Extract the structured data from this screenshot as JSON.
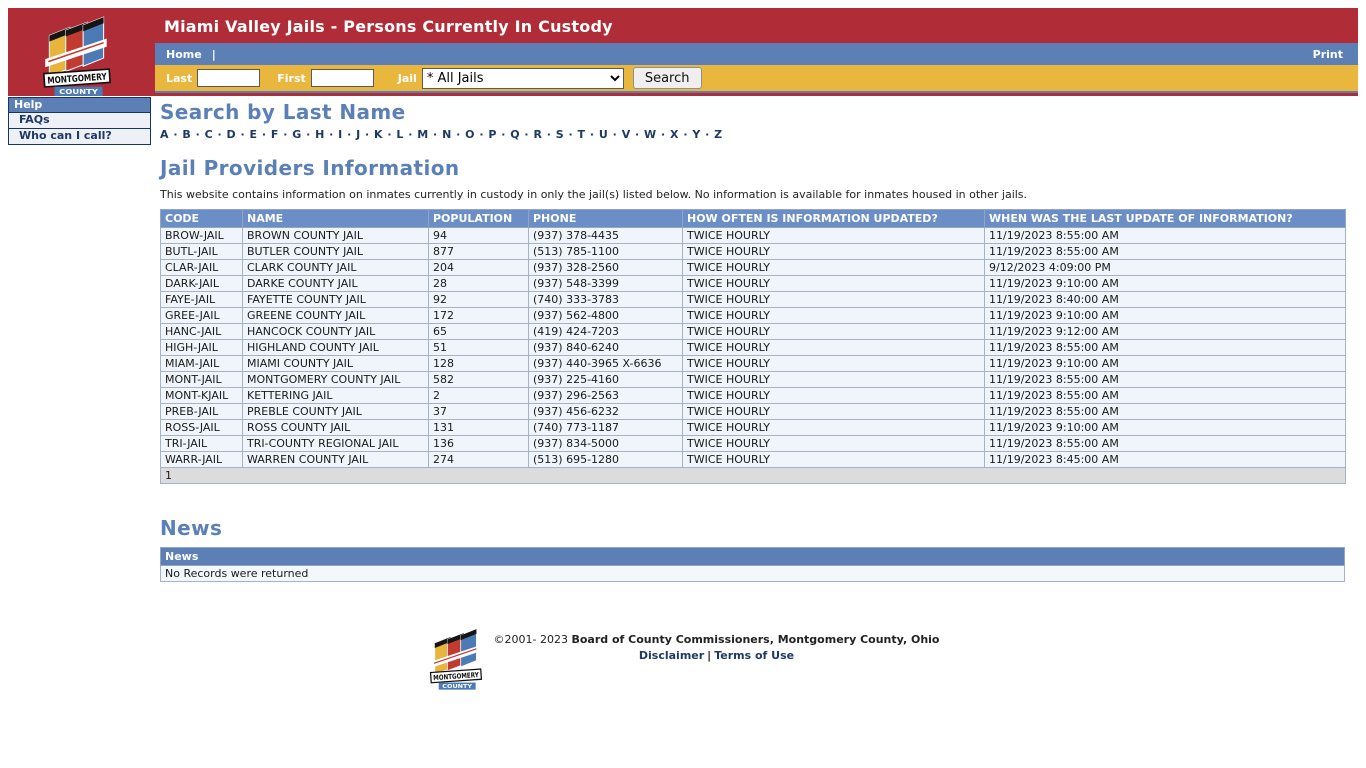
{
  "header": {
    "title": "Miami Valley Jails - Persons Currently In Custody",
    "nav": {
      "home_label": "Home",
      "separator": "|",
      "print_label": "Print"
    },
    "search_bar": {
      "last_label": "Last",
      "last_value": "",
      "first_label": "First",
      "first_value": "",
      "jail_label": "Jail",
      "jail_selected": "* All Jails",
      "search_button": "Search"
    }
  },
  "logo": {
    "line1": "MONTGOMERY",
    "line2": "COUNTY"
  },
  "sidebar": {
    "header": "Help",
    "items": [
      {
        "label": "FAQs"
      },
      {
        "label": "Who can I call?"
      }
    ]
  },
  "main": {
    "search_section": {
      "heading": "Search by Last Name",
      "letters": [
        "A",
        "B",
        "C",
        "D",
        "E",
        "F",
        "G",
        "H",
        "I",
        "J",
        "K",
        "L",
        "M",
        "N",
        "O",
        "P",
        "Q",
        "R",
        "S",
        "T",
        "U",
        "V",
        "W",
        "X",
        "Y",
        "Z"
      ]
    },
    "providers_section": {
      "heading": "Jail Providers Information",
      "description": "This website contains information on inmates currently in custody in only the jail(s) listed below. No information is available for inmates housed in other jails.",
      "table": {
        "columns": [
          "CODE",
          "NAME",
          "POPULATION",
          "PHONE",
          "HOW OFTEN IS INFORMATION UPDATED?",
          "WHEN WAS THE LAST UPDATE OF INFORMATION?"
        ],
        "rows": [
          {
            "code": "BROW-JAIL",
            "name": "BROWN COUNTY JAIL",
            "population": "94",
            "phone": "(937) 378-4435",
            "updated": "TWICE HOURLY",
            "last_update": "11/19/2023 8:55:00 AM"
          },
          {
            "code": "BUTL-JAIL",
            "name": "BUTLER COUNTY JAIL",
            "population": "877",
            "phone": "(513) 785-1100",
            "updated": "TWICE HOURLY",
            "last_update": "11/19/2023 8:55:00 AM"
          },
          {
            "code": "CLAR-JAIL",
            "name": "CLARK COUNTY JAIL",
            "population": "204",
            "phone": "(937) 328-2560",
            "updated": "TWICE HOURLY",
            "last_update": "9/12/2023 4:09:00 PM"
          },
          {
            "code": "DARK-JAIL",
            "name": "DARKE COUNTY JAIL",
            "population": "28",
            "phone": "(937) 548-3399",
            "updated": "TWICE HOURLY",
            "last_update": "11/19/2023 9:10:00 AM"
          },
          {
            "code": "FAYE-JAIL",
            "name": "FAYETTE COUNTY JAIL",
            "population": "92",
            "phone": "(740) 333-3783",
            "updated": "TWICE HOURLY",
            "last_update": "11/19/2023 8:40:00 AM"
          },
          {
            "code": "GREE-JAIL",
            "name": "GREENE COUNTY JAIL",
            "population": "172",
            "phone": "(937) 562-4800",
            "updated": "TWICE HOURLY",
            "last_update": "11/19/2023 9:10:00 AM"
          },
          {
            "code": "HANC-JAIL",
            "name": "HANCOCK COUNTY JAIL",
            "population": "65",
            "phone": "(419) 424-7203",
            "updated": "TWICE HOURLY",
            "last_update": "11/19/2023 9:12:00 AM"
          },
          {
            "code": "HIGH-JAIL",
            "name": "HIGHLAND COUNTY JAIL",
            "population": "51",
            "phone": "(937) 840-6240",
            "updated": "TWICE HOURLY",
            "last_update": "11/19/2023 8:55:00 AM"
          },
          {
            "code": "MIAM-JAIL",
            "name": "MIAMI COUNTY JAIL",
            "population": "128",
            "phone": "(937) 440-3965 X-6636",
            "updated": "TWICE HOURLY",
            "last_update": "11/19/2023 9:10:00 AM"
          },
          {
            "code": "MONT-JAIL",
            "name": "MONTGOMERY COUNTY JAIL",
            "population": "582",
            "phone": "(937) 225-4160",
            "updated": "TWICE HOURLY",
            "last_update": "11/19/2023 8:55:00 AM"
          },
          {
            "code": "MONT-KJAIL",
            "name": "KETTERING JAIL",
            "population": "2",
            "phone": "(937) 296-2563",
            "updated": "TWICE HOURLY",
            "last_update": "11/19/2023 8:55:00 AM"
          },
          {
            "code": "PREB-JAIL",
            "name": "PREBLE COUNTY JAIL",
            "population": "37",
            "phone": "(937) 456-6232",
            "updated": "TWICE HOURLY",
            "last_update": "11/19/2023 8:55:00 AM"
          },
          {
            "code": "ROSS-JAIL",
            "name": "ROSS COUNTY JAIL",
            "population": "131",
            "phone": "(740) 773-1187",
            "updated": "TWICE HOURLY",
            "last_update": "11/19/2023 9:10:00 AM"
          },
          {
            "code": "TRI-JAIL",
            "name": "TRI-COUNTY REGIONAL JAIL",
            "population": "136",
            "phone": "(937) 834-5000",
            "updated": "TWICE HOURLY",
            "last_update": "11/19/2023 8:55:00 AM"
          },
          {
            "code": "WARR-JAIL",
            "name": "WARREN COUNTY JAIL",
            "population": "274",
            "phone": "(513) 695-1280",
            "updated": "TWICE HOURLY",
            "last_update": "11/19/2023 8:45:00 AM"
          }
        ],
        "pager": "1"
      }
    },
    "news_section": {
      "heading": "News",
      "table_header": "News",
      "empty_message": "No Records were returned"
    }
  },
  "footer": {
    "copyright_prefix": "©2001- 2023",
    "copyright_org": "Board of County Commissioners, Montgomery County, Ohio",
    "links": [
      {
        "label": "Disclaimer"
      },
      {
        "label": "Terms of Use"
      }
    ],
    "link_separator": "|"
  },
  "colors": {
    "header_red": "#B02C36",
    "nav_blue": "#5C80B6",
    "gold": "#EAB73E",
    "heading_blue": "#5B80B8",
    "table_header_blue": "#6C8EC6",
    "navy_text": "#1F3864"
  }
}
